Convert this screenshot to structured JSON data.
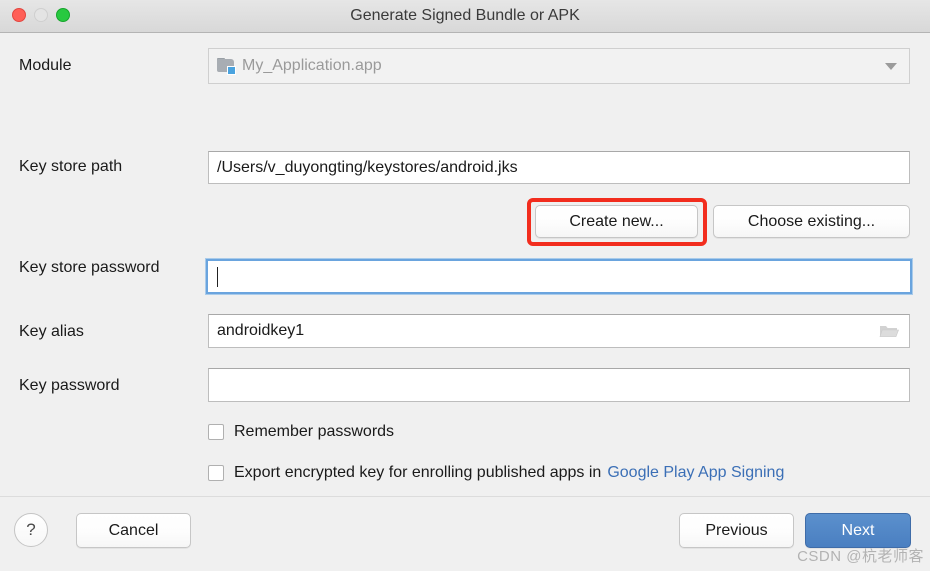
{
  "window": {
    "title": "Generate Signed Bundle or APK",
    "controls": {
      "close": "close-button",
      "minimize": "minimize-button",
      "maximize": "maximize-button"
    }
  },
  "form": {
    "module": {
      "label": "Module",
      "value": "My_Application.app",
      "icon": "module-icon",
      "dropdown_icon": "chevron-down-icon",
      "disabled": true
    },
    "key_store_path": {
      "label": "Key store path",
      "value": "/Users/v_duyongting/keystores/android.jks",
      "placeholder": ""
    },
    "keystore_buttons": {
      "create_new": "Create new...",
      "choose_existing": "Choose existing..."
    },
    "key_store_password": {
      "label": "Key store password",
      "value": "",
      "focused": true
    },
    "key_alias": {
      "label": "Key alias",
      "value": "androidkey1",
      "browse_icon": "folder-icon"
    },
    "key_password": {
      "label": "Key password",
      "value": ""
    },
    "remember_passwords": {
      "label": "Remember passwords",
      "checked": false
    },
    "export_encrypted_key": {
      "label": "Export encrypted key for enrolling published apps in",
      "link_label": "Google Play App Signing",
      "checked": false
    }
  },
  "footer": {
    "help": "?",
    "cancel": "Cancel",
    "previous": "Previous",
    "next": "Next"
  },
  "annotation": {
    "target": "Create new...",
    "color": "#f22d1e"
  },
  "watermark": "CSDN @杭老师客"
}
